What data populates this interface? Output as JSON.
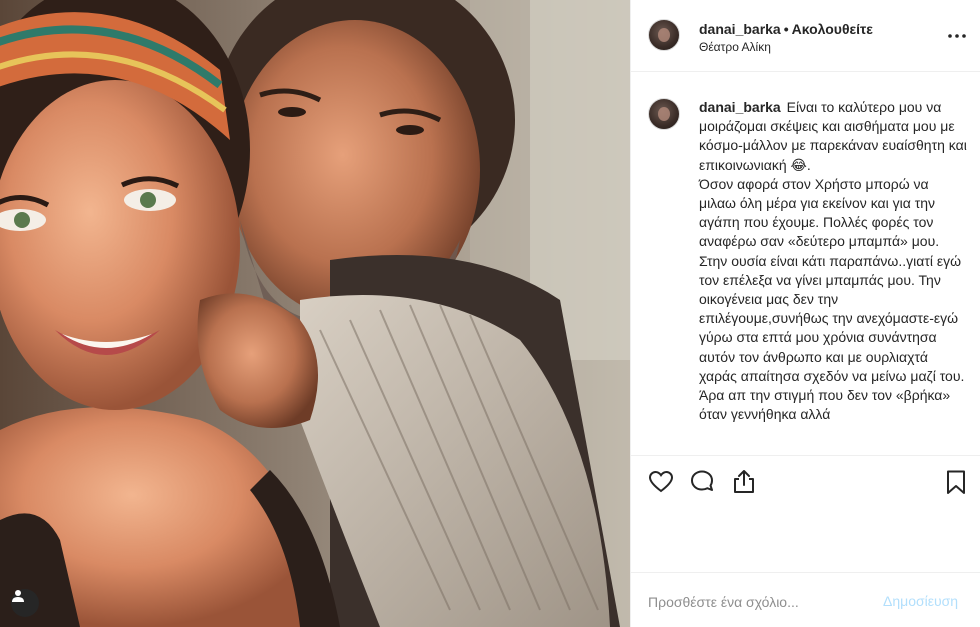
{
  "post": {
    "username": "danai_barka",
    "separator": "•",
    "follow_status": "Ακολουθείτε",
    "location": "Θέατρο Αλίκη",
    "more_icon": "more-horizontal-icon",
    "caption": "Είναι το καλύτερο μου να μοιράζομαι σκέψεις και αισθήματα μου με κόσμο-μάλλον με παρεκάναν ευαίσθητη και επικοινωνιακή 😂.\nΌσον αφορά στον Χρήστο μπορώ να μιλαω όλη μέρα για εκείνον και για την αγάπη που έχουμε. Πολλές φορές τον αναφέρω σαν «δεύτερο μπαμπά» μου. Στην ουσία είναι κάτι παραπάνω..γιατί εγώ τον επέλεξα να γίνει μπαμπάς μου. Την οικογένεια μας δεν την επιλέγουμε,συνήθως την ανεχόμαστε-εγώ γύρω στα επτά μου χρόνια συνάντησα αυτόν τον άνθρωπο και με ουρλιαχτά χαράς απαίτησα σχεδόν να μείνω μαζί του. Άρα απ την στιγμή που δεν τον «βρήκα» όταν γεννήθηκα αλλά"
  },
  "actions": {
    "like_icon": "heart-icon",
    "comment_icon": "comment-bubble-icon",
    "share_icon": "share-icon",
    "save_icon": "bookmark-icon"
  },
  "comment": {
    "placeholder": "Προσθέστε ένα σχόλιο...",
    "post_label": "Δημοσίευση"
  },
  "photo": {
    "user_tag_icon": "tagged-user-icon"
  },
  "colors": {
    "text": "#262626",
    "secondary": "#8e8e8e",
    "border": "#efefef",
    "post_disabled": "#b2dffc"
  }
}
